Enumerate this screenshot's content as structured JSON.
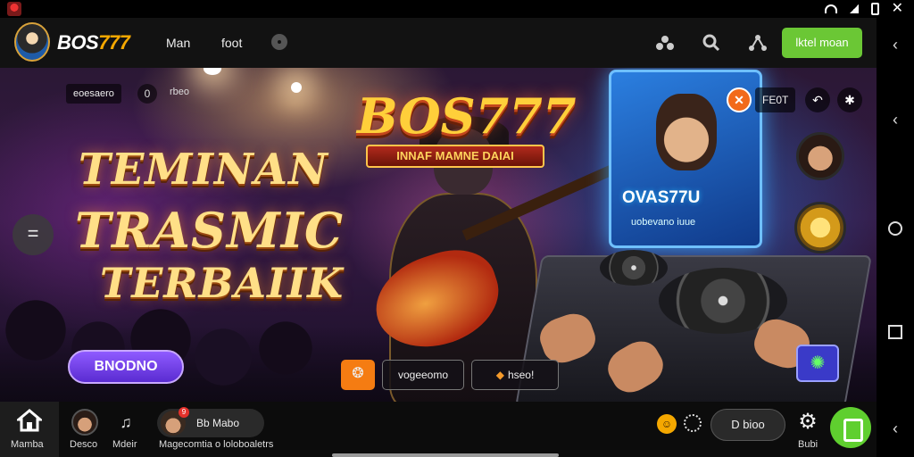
{
  "app_bar": {
    "brand_part1": "BOS",
    "brand_part2": "777",
    "nav": [
      "Man",
      "foot"
    ],
    "login_label": "lktel moan"
  },
  "hero": {
    "chip_left": "eoesaero",
    "chip_circle": "0",
    "chip_text": "rbeo",
    "headline": [
      "TEMINAN",
      "TRASMIC",
      "TERBAIIK"
    ],
    "cta_label": "BNODNO",
    "logo_title": "BOS777",
    "logo_subtitle": "INNAF MAMNE DAIAI",
    "screen_title": "OVAS77U",
    "screen_sub": "uobevano iuue",
    "dj_chip": "FE0T",
    "btn_orange_glyph": "❂",
    "btn1": "vogeeomo",
    "btn2_mark": "◆",
    "btn2": "hseo!"
  },
  "bottom_bar": {
    "home_label": "Mamba",
    "tab2_label": "Desco",
    "tab3_label": "Mdeir",
    "pill_text": "Bb Mabo",
    "pill_badge": "9",
    "pill_caption": "Magecomtia  o  loloboaletrs",
    "btn_pill": "D bioo",
    "settings_label": "Bubi"
  },
  "colors": {
    "accent_green": "#6bc735",
    "brand_gold": "#f5a800",
    "cta_purple": "#7a45f0",
    "orange": "#f57c12"
  }
}
